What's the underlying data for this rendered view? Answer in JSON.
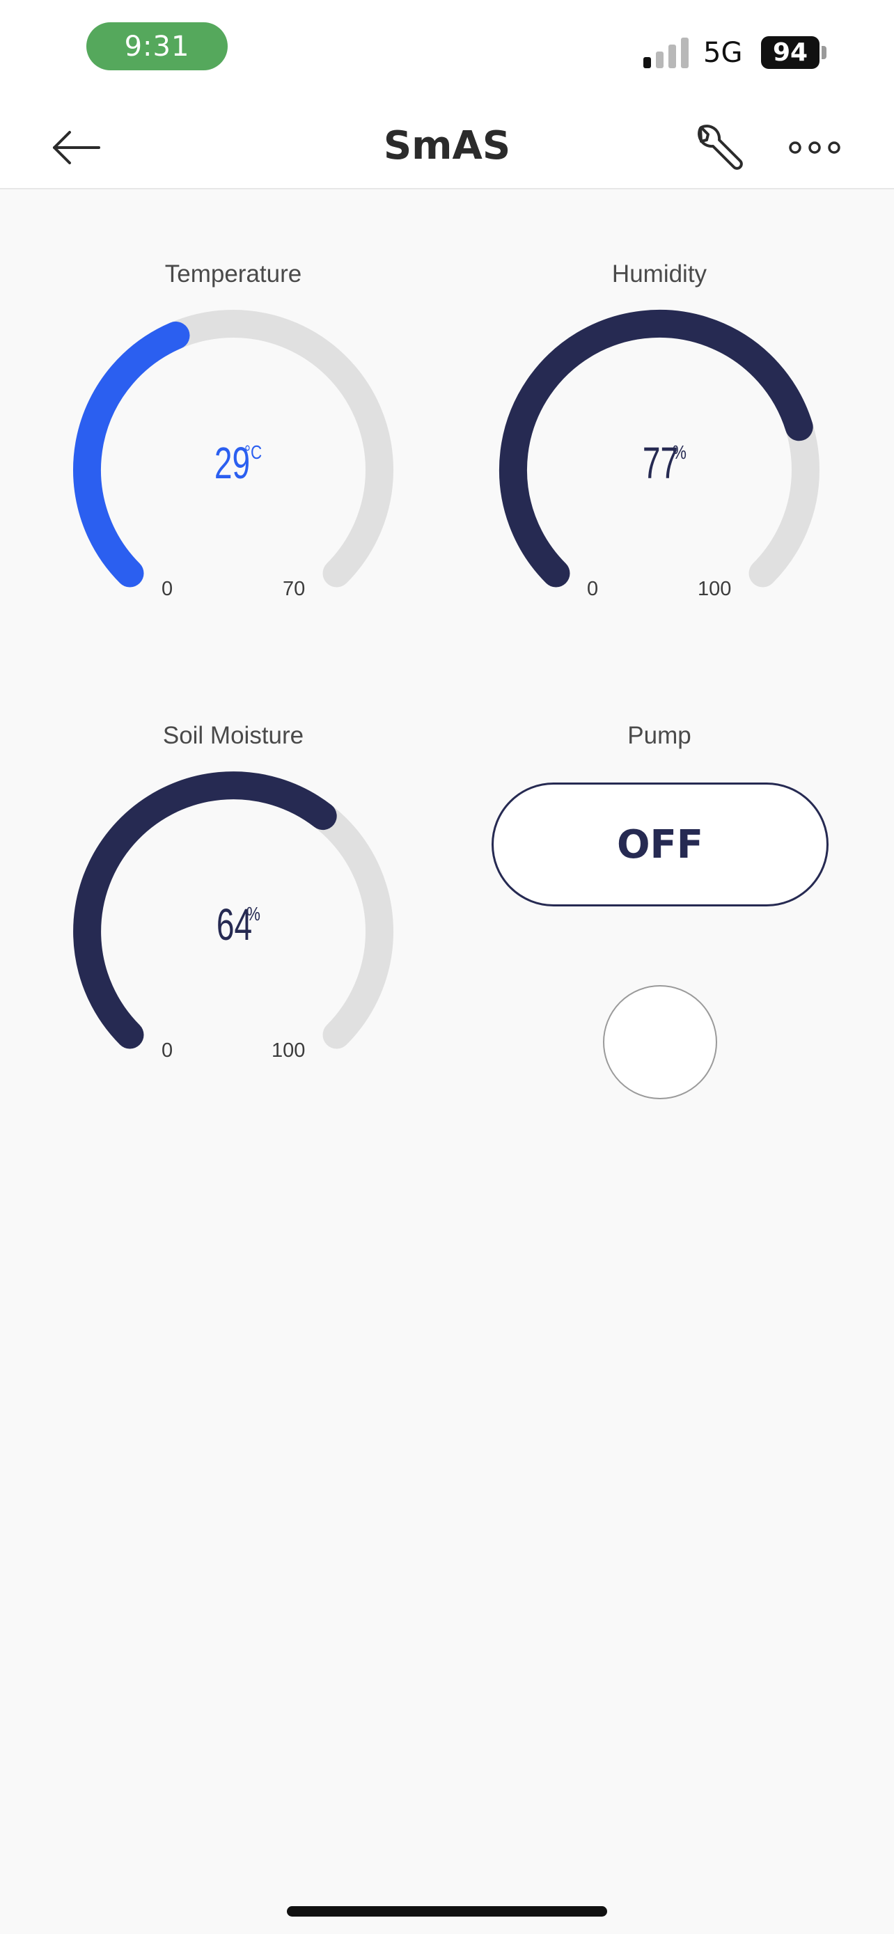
{
  "status_bar": {
    "time": "9:31",
    "network": "5G",
    "battery": "94",
    "signal_bars_active": 1,
    "signal_bars_total": 4
  },
  "header": {
    "title": "SmAS",
    "back_icon": "arrow-left-icon",
    "settings_icon": "wrench-icon",
    "more_icon": "more-horizontal-icon"
  },
  "widgets": {
    "temperature": {
      "label": "Temperature",
      "value": "29",
      "unit": "°C",
      "min": "0",
      "max": "70",
      "color": "#2b5ff0"
    },
    "humidity": {
      "label": "Humidity",
      "value": "77",
      "unit": "%",
      "min": "0",
      "max": "100",
      "color": "#262a52"
    },
    "soil_moisture": {
      "label": "Soil Moisture",
      "value": "64",
      "unit": "%",
      "min": "0",
      "max": "100",
      "color": "#262a52"
    },
    "pump": {
      "label": "Pump",
      "button_label": "OFF",
      "led_state": "off"
    }
  },
  "colors": {
    "track": "#e0e0e0",
    "dark": "#262a52",
    "accent_blue": "#2b5ff0",
    "time_pill": "#55a85c"
  }
}
